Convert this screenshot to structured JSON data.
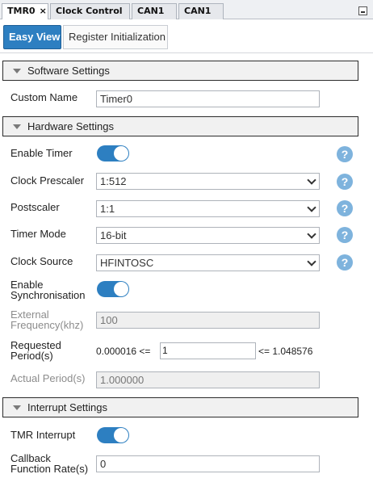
{
  "doc_tabs": [
    {
      "label": "TMR0",
      "close": "×"
    },
    {
      "label": "Clock Control"
    },
    {
      "label": "CAN1"
    },
    {
      "label": "CAN1"
    }
  ],
  "view_tabs": {
    "easy": "Easy View",
    "register": "Register Initialization"
  },
  "software": {
    "title": "Software Settings",
    "custom_name_label": "Custom Name",
    "custom_name_value": "Timer0"
  },
  "hardware": {
    "title": "Hardware Settings",
    "enable_timer_label": "Enable Timer",
    "enable_timer_on": true,
    "clock_prescaler_label": "Clock Prescaler",
    "clock_prescaler_value": "1:512",
    "postscaler_label": "Postscaler",
    "postscaler_value": "1:1",
    "timer_mode_label": "Timer Mode",
    "timer_mode_value": "16-bit",
    "clock_source_label": "Clock Source",
    "clock_source_value": "HFINTOSC",
    "enable_sync_label_1": "Enable",
    "enable_sync_label_2": "Synchronisation",
    "enable_sync_on": true,
    "ext_freq_label_1": "External",
    "ext_freq_label_2": "Frequency(khz)",
    "ext_freq_value": "100",
    "req_period_label_1": "Requested",
    "req_period_label_2": "Period(s)",
    "req_period_min": "0.000016 <=",
    "req_period_value": "1",
    "req_period_max": "<= 1.048576",
    "actual_period_label": "Actual Period(s)",
    "actual_period_value": "1.000000",
    "help_glyph": "?"
  },
  "interrupt": {
    "title": "Interrupt Settings",
    "tmr_interrupt_label": "TMR Interrupt",
    "tmr_interrupt_on": true,
    "callback_label_1": "Callback",
    "callback_label_2": "Function Rate(s)",
    "callback_value": "0"
  },
  "colors": {
    "accent": "#2d7fc1",
    "help": "#7eb3dd"
  },
  "icons": {
    "collapse": "triangle-down-icon",
    "help": "help-icon",
    "dropdown": "chevron-down-icon",
    "panel": "minimize-icon"
  }
}
